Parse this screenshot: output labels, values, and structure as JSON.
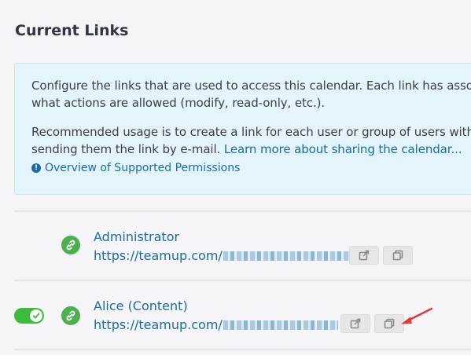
{
  "page": {
    "title": "Current Links"
  },
  "info": {
    "p1_line1": "Configure the links that are used to access this calendar. Each link has associated",
    "p1_line2": "what actions are allowed (modify, read-only, etc.).",
    "p2_line1": "Recommended usage is to create a link for each user or group of users with",
    "p2_line2_text": "sending them the link by e-mail. ",
    "p2_link": "Learn more about sharing the calendar...",
    "overview_link": "Overview of Supported Permissions",
    "overview_icon": "exclamation-circle-icon"
  },
  "links": [
    {
      "name": "Administrator",
      "url_prefix": "https://teamup.com/",
      "enabled_toggle_visible": false,
      "icon": "link-icon"
    },
    {
      "name": "Alice (Content)",
      "url_prefix": "https://teamup.com/",
      "enabled_toggle_visible": true,
      "enabled": true,
      "icon": "link-icon"
    }
  ],
  "colors": {
    "accent_link": "#1a6aa6",
    "info_bg": "#e3f5fb",
    "status_green": "#4caf50",
    "toggle_green": "#3dbb3d",
    "annotation_arrow": "#e53935"
  }
}
